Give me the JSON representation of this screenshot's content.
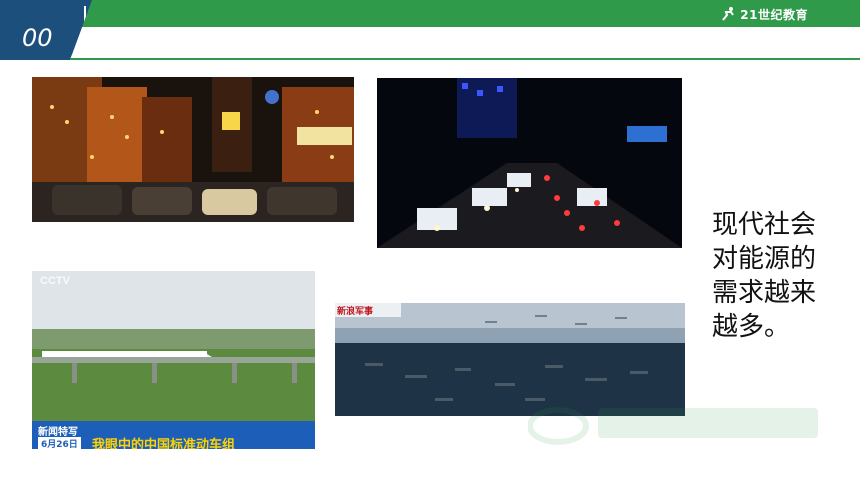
{
  "header": {
    "page_number": "00",
    "brand": "21世纪教育",
    "brand_icon": "runner-logo-icon"
  },
  "caption": {
    "lines": [
      "现代社会",
      "对能源的",
      "需求越来",
      "越多。"
    ]
  },
  "images": {
    "cctv_logo": "CCTV",
    "news_label": "新闻特写",
    "date_label": "6月26日",
    "headline": "我眼中的中国标准动车组",
    "sina_logo": "新浪军事"
  },
  "colors": {
    "accent_green": "#2f9a4a",
    "badge_blue": "#1d4f7d"
  }
}
